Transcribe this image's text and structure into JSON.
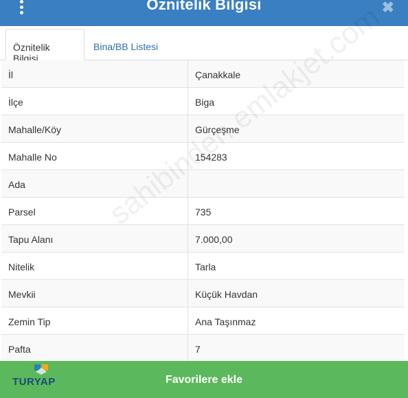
{
  "header": {
    "title": "Öznitelik Bilgisi",
    "menu_icon": "kebab-menu-icon",
    "close_icon": "close-icon",
    "close_glyph": "✖",
    "color": "#3a7fc1"
  },
  "tabs": [
    {
      "label": "Öznitelik Bilgisi",
      "active": true
    },
    {
      "label": "Bina/BB Listesi",
      "active": false
    }
  ],
  "attributes": [
    {
      "key": "İl",
      "value": "Çanakkale"
    },
    {
      "key": "İlçe",
      "value": "Biga"
    },
    {
      "key": "Mahalle/Köy",
      "value": "Gürçeşme"
    },
    {
      "key": "Mahalle No",
      "value": "154283"
    },
    {
      "key": "Ada",
      "value": ""
    },
    {
      "key": "Parsel",
      "value": "735"
    },
    {
      "key": "Tapu Alanı",
      "value": "7.000,00"
    },
    {
      "key": "Nitelik",
      "value": "Tarla"
    },
    {
      "key": "Mevkii",
      "value": "Küçük Havdan"
    },
    {
      "key": "Zemin Tip",
      "value": "Ana Taşınmaz"
    },
    {
      "key": "Pafta",
      "value": "7"
    }
  ],
  "watermark": "sahibinden emlakjet.com",
  "footer": {
    "button_label": "Favorilere ekle",
    "color": "#5cb85c",
    "logo_text": "TURYAP"
  }
}
